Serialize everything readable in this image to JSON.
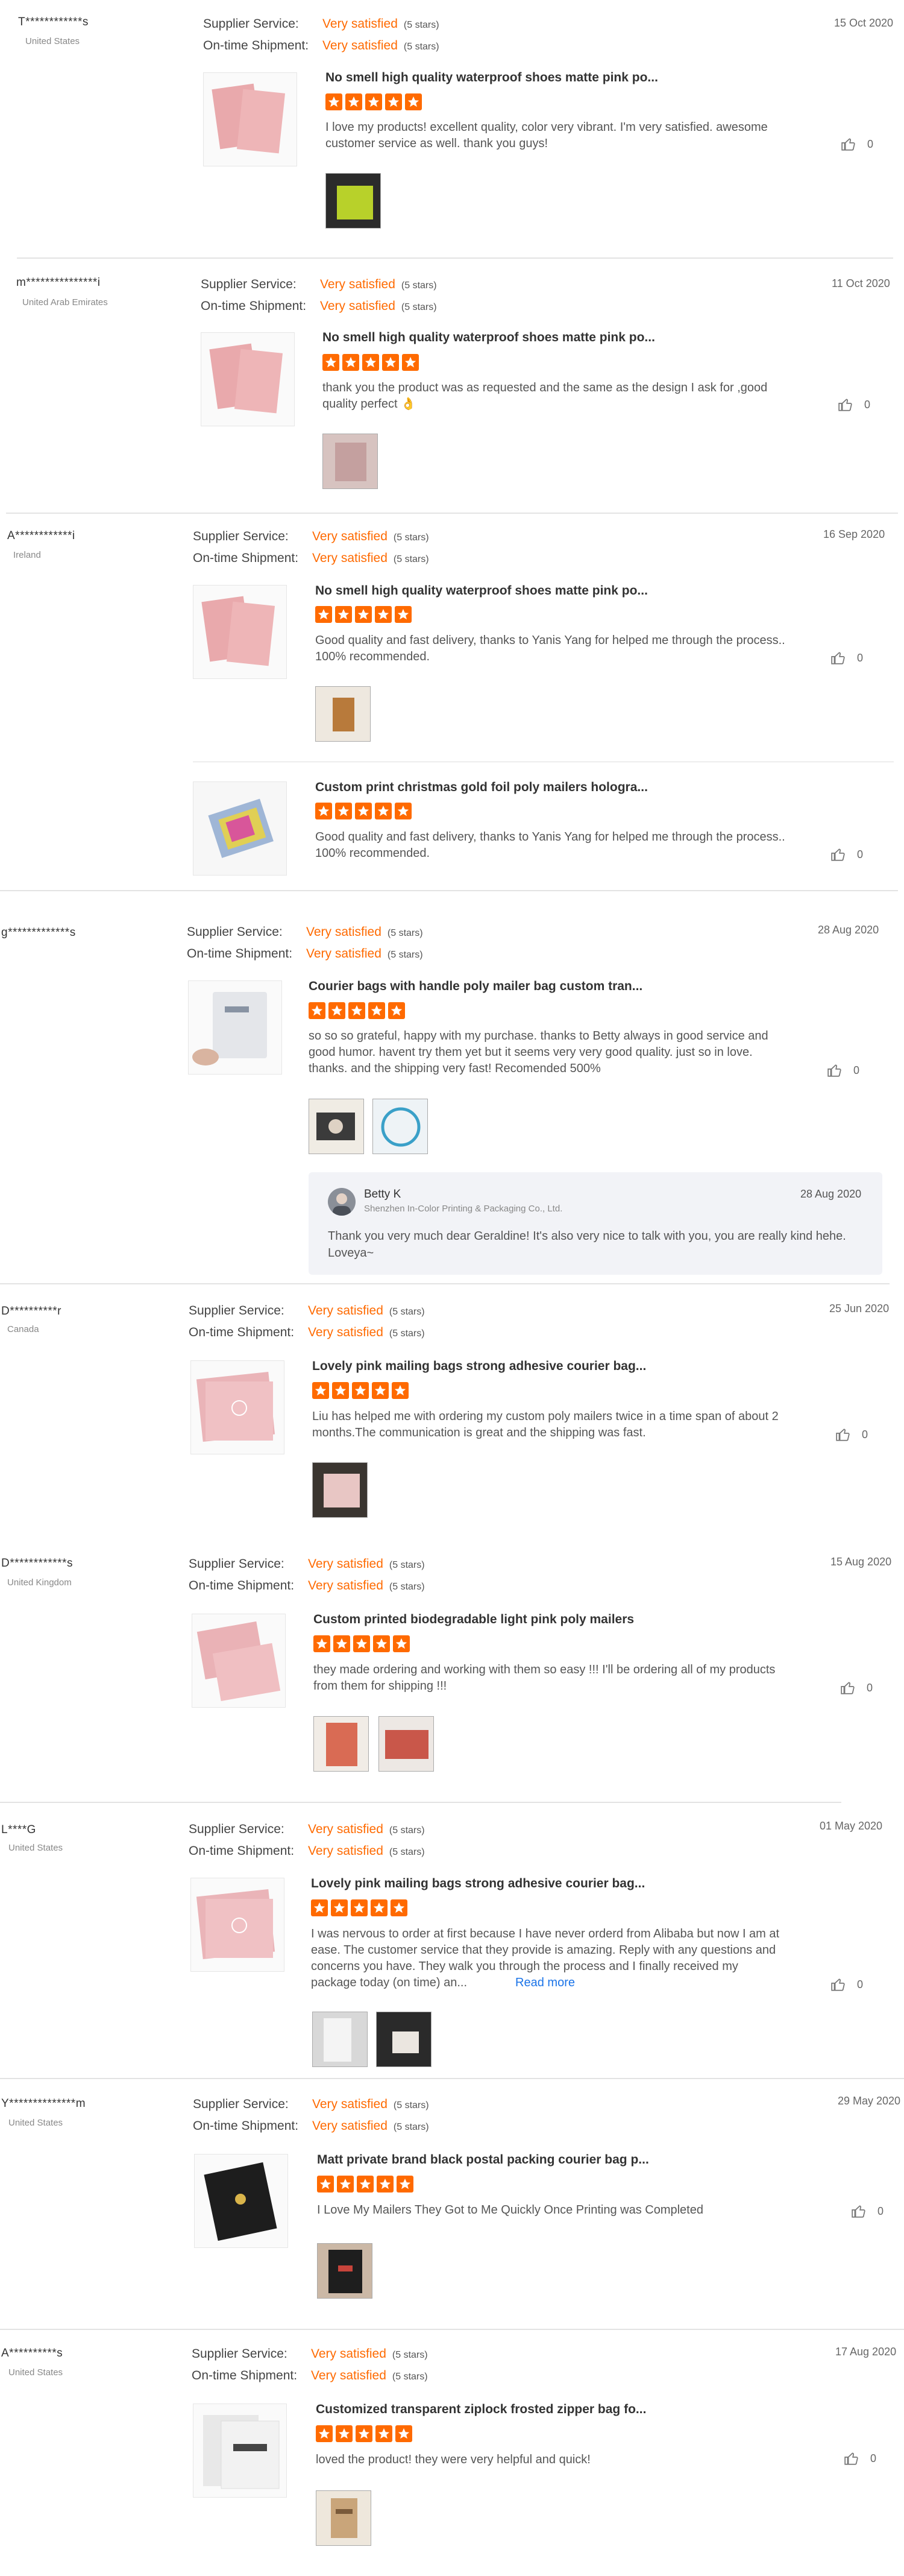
{
  "labels": {
    "supplier_service": "Supplier Service:",
    "on_time_shipment": "On-time Shipment:",
    "rating_value": "Very satisfied",
    "rating_stars": "(5 stars)",
    "read_more": "Read more"
  },
  "reviews": [
    {
      "user": "T************s",
      "country": "United States",
      "date": "15 Oct 2020",
      "items": [
        {
          "title": "No smell high quality waterproof shoes matte pink po...",
          "text": "I love my products! excellent quality, color very vibrant. I'm very satisfied. awesome customer service as well. thank you guys!",
          "likes": "0",
          "rating": 5
        }
      ]
    },
    {
      "user": "m***************i",
      "country": "United Arab Emirates",
      "date": "11 Oct 2020",
      "items": [
        {
          "title": "No smell high quality waterproof shoes matte pink po...",
          "text": "thank you the product was as requested and the same as the design I ask for ,good quality perfect 👌",
          "likes": "0",
          "rating": 5
        }
      ]
    },
    {
      "user": "A************i",
      "country": "Ireland",
      "date": "16 Sep 2020",
      "items": [
        {
          "title": "No smell high quality waterproof shoes matte pink po...",
          "text": "Good quality and fast delivery, thanks to Yanis Yang for helped me through the process.. 100% recommended.",
          "likes": "0",
          "rating": 5
        },
        {
          "title": "Custom print christmas gold foil poly mailers hologra...",
          "text": "Good quality and fast delivery, thanks to Yanis Yang for helped me through the process.. 100% recommended.",
          "likes": "0",
          "rating": 5
        }
      ]
    },
    {
      "user": "g*************s",
      "country": "",
      "date": "28 Aug 2020",
      "items": [
        {
          "title": "Courier bags with handle poly mailer bag custom tran...",
          "text": "so so so grateful, happy with my purchase. thanks to Betty always in good service and good humor. havent try them yet but it seems very very good quality. just so in love. thanks. and the shipping very fast! Recomended 500%",
          "likes": "0",
          "rating": 5
        }
      ],
      "reply": {
        "name": "Betty K",
        "company": "Shenzhen In-Color Printing & Packaging Co., Ltd.",
        "date": "28 Aug 2020",
        "text": "Thank you very much dear Geraldine!   It's also very nice to talk with you, you are really kind hehe. Loveya~"
      }
    },
    {
      "user": "D**********r",
      "country": "Canada",
      "date": "25 Jun 2020",
      "items": [
        {
          "title": "Lovely pink mailing bags strong adhesive courier bag...",
          "text": "Liu has helped me with ordering my custom poly mailers twice in a time span of about 2 months.The communication is great and the shipping was fast.",
          "likes": "0",
          "rating": 5
        }
      ]
    },
    {
      "user": "D************s",
      "country": "United Kingdom",
      "date": "15 Aug 2020",
      "items": [
        {
          "title": "Custom printed biodegradable light pink poly mailers",
          "text": "they made ordering and working with them so easy !!! I'll be ordering all of my products from them for shipping !!!",
          "likes": "0",
          "rating": 5
        }
      ]
    },
    {
      "user": "L****G",
      "country": "United States",
      "date": "01 May 2020",
      "items": [
        {
          "title": "Lovely pink mailing bags strong adhesive courier bag...",
          "text": "I was nervous to order at first because I have never orderd from Alibaba but now I am at ease. The customer service that they provide is amazing. Reply with any questions and concerns you have. They walk you through the process and I finally received my package today (on time) an...",
          "likes": "0",
          "rating": 5,
          "read_more": true
        }
      ]
    },
    {
      "user": "Y**************m",
      "country": "United States",
      "date": "29 May 2020",
      "items": [
        {
          "title": "Matt private brand black postal packing courier bag p...",
          "text": "I Love My Mailers They Got to Me Quickly Once Printing was Completed",
          "likes": "0",
          "rating": 5
        }
      ]
    },
    {
      "user": "A**********s",
      "country": "United States",
      "date": "17 Aug 2020",
      "items": [
        {
          "title": "Customized transparent ziplock frosted zipper bag fo...",
          "text": "loved the product! they were very helpful and quick!",
          "likes": "0",
          "rating": 5
        }
      ]
    }
  ]
}
